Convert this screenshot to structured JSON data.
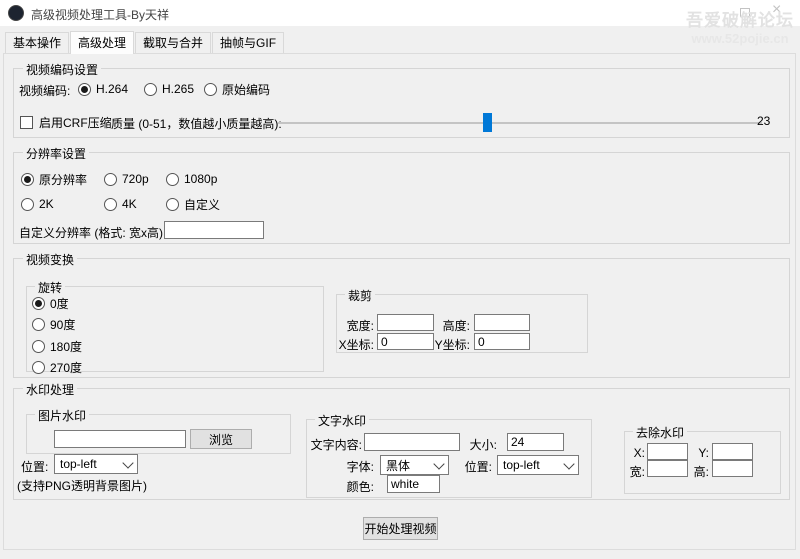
{
  "window": {
    "title": "高级视频处理工具-By天祥"
  },
  "overlay": {
    "watermark_line1": "吾爱破解论坛",
    "watermark_line2": "www.52pojie.cn"
  },
  "tabs": {
    "basic": "基本操作",
    "advanced": "高级处理",
    "cut_merge": "截取与合并",
    "frames_gif": "抽帧与GIF",
    "active_tab": "高级处理"
  },
  "encoding": {
    "group_title": "视频编码设置",
    "codec_label": "视频编码:",
    "opt_h264": "H.264",
    "opt_h265": "H.265",
    "opt_original": "原始编码",
    "selected_codec": "H.264",
    "crf_checkbox_label": "启用CRF压缩",
    "crf_checked": false,
    "quality_label": "质量 (0-51，数值越小质量越高):",
    "quality_value": "23",
    "quality_min": 0,
    "quality_max": 51
  },
  "resolution": {
    "group_title": "分辨率设置",
    "opt_original": "原分辨率",
    "opt_720p": "720p",
    "opt_1080p": "1080p",
    "opt_2k": "2K",
    "opt_4k": "4K",
    "opt_custom": "自定义",
    "selected": "原分辨率",
    "custom_label": "自定义分辨率 (格式: 宽x高):",
    "custom_value": ""
  },
  "transform": {
    "group_title": "视频变换",
    "rotate": {
      "group_title": "旋转",
      "opt_0": "0度",
      "opt_90": "90度",
      "opt_180": "180度",
      "opt_270": "270度",
      "selected": "0度"
    },
    "crop": {
      "group_title": "裁剪",
      "width_label": "宽度:",
      "height_label": "高度:",
      "x_label": "X坐标:",
      "y_label": "Y坐标:",
      "width_value": "",
      "height_value": "",
      "x_value": "0",
      "y_value": "0"
    }
  },
  "watermark": {
    "group_title": "水印处理",
    "image": {
      "group_title": "图片水印",
      "path_value": "",
      "browse_label": "浏览",
      "position_label": "位置:",
      "position_value": "top-left",
      "hint": "(支持PNG透明背景图片)"
    },
    "text": {
      "group_title": "文字水印",
      "content_label": "文字内容:",
      "content_value": "",
      "size_label": "大小:",
      "size_value": "24",
      "font_label": "字体:",
      "font_value": "黑体",
      "position_label": "位置:",
      "position_value": "top-left",
      "color_label": "颜色:",
      "color_value": "white"
    },
    "remove": {
      "group_title": "去除水印",
      "x_label": "X:",
      "y_label": "Y:",
      "w_label": "宽:",
      "h_label": "高:",
      "x_value": "",
      "y_value": "",
      "w_value": "",
      "h_value": ""
    }
  },
  "action": {
    "start_button": "开始处理视频"
  },
  "colors": {
    "accent": "#0078d7",
    "watermark_gray": "#e2e2e2"
  }
}
